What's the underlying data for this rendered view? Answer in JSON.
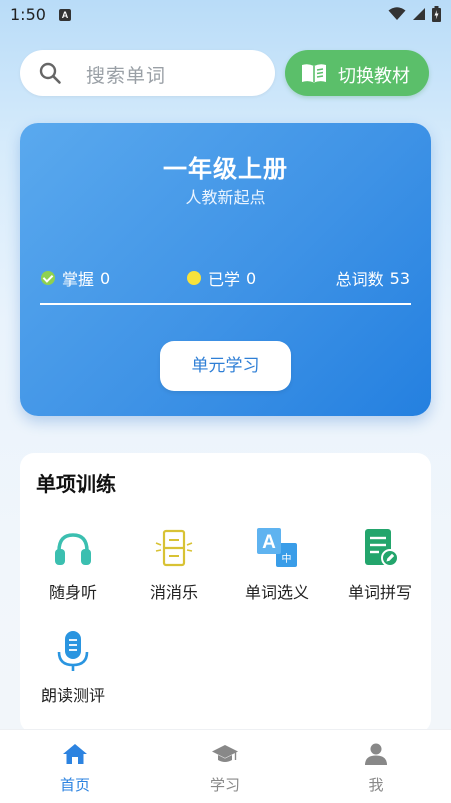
{
  "status_bar": {
    "time": "1:50",
    "notification_letter": "A"
  },
  "search": {
    "placeholder": "搜索单词"
  },
  "switch_textbook": {
    "label": "切换教材"
  },
  "book": {
    "title": "一年级上册",
    "subtitle": "人教新起点",
    "mastered_label": "掌握",
    "mastered_count": "0",
    "learned_label": "已学",
    "learned_count": "0",
    "total_label": "总词数",
    "total_count": "53",
    "unit_button": "单元学习"
  },
  "training": {
    "title": "单项训练",
    "items": [
      {
        "label": "随身听",
        "icon": "headphones-icon"
      },
      {
        "label": "消消乐",
        "icon": "match-game-icon"
      },
      {
        "label": "单词选义",
        "icon": "translate-icon"
      },
      {
        "label": "单词拼写",
        "icon": "spelling-icon"
      },
      {
        "label": "朗读测评",
        "icon": "microphone-icon"
      }
    ]
  },
  "nav": [
    {
      "label": "首页",
      "icon": "home-icon",
      "active": true
    },
    {
      "label": "学习",
      "icon": "graduation-cap-icon",
      "active": false
    },
    {
      "label": "我",
      "icon": "user-icon",
      "active": false
    }
  ],
  "colors": {
    "accent_blue": "#2c83e0",
    "green_button": "#5bbf6a",
    "card_gradient_start": "#5aa9ee",
    "card_gradient_end": "#2480e0"
  }
}
